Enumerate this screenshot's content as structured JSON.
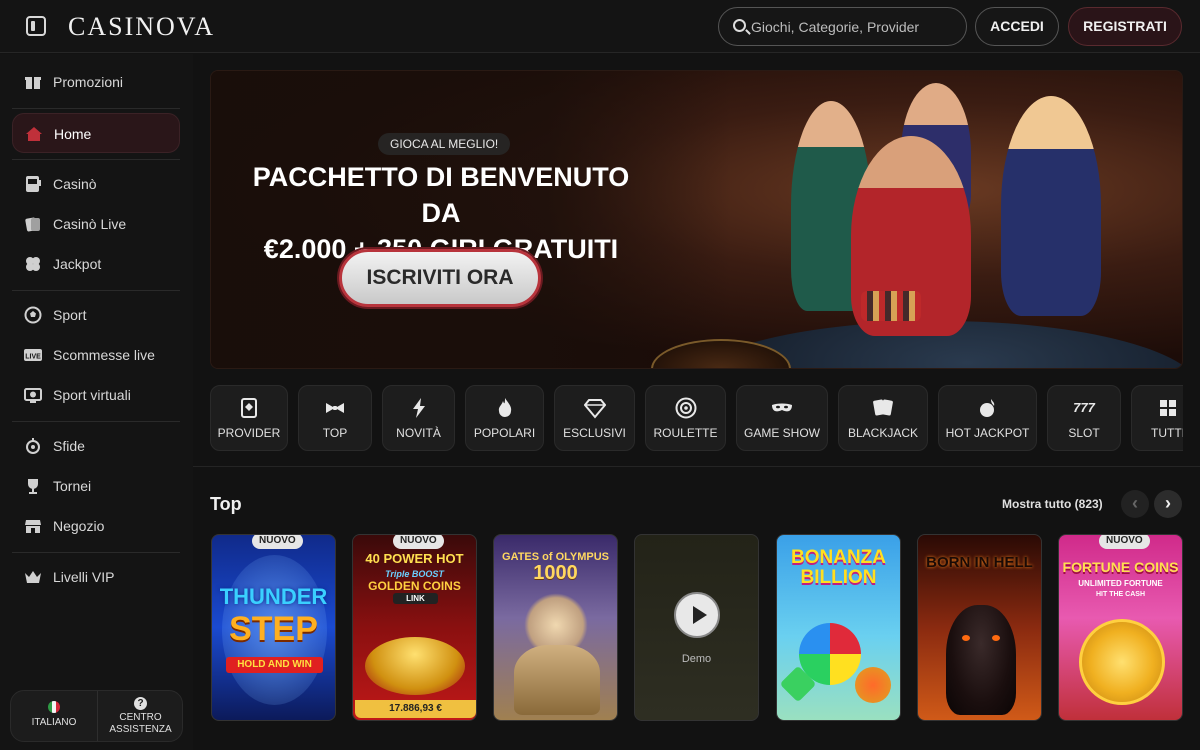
{
  "header": {
    "logo": "CASINOVA",
    "search_placeholder": "Giochi, Categorie, Provider",
    "login_label": "ACCEDI",
    "register_label": "REGISTRATI"
  },
  "sidebar": {
    "items": [
      {
        "label": "Promozioni",
        "icon": "gift-icon"
      },
      {
        "label": "Home",
        "icon": "home-icon",
        "active": true
      },
      {
        "label": "Casinò",
        "icon": "slot-machine-icon"
      },
      {
        "label": "Casinò Live",
        "icon": "live-cards-icon"
      },
      {
        "label": "Jackpot",
        "icon": "clover-icon"
      },
      {
        "label": "Sport",
        "icon": "soccer-ball-icon"
      },
      {
        "label": "Scommesse live",
        "icon": "live-icon"
      },
      {
        "label": "Sport virtuali",
        "icon": "virtual-sport-icon"
      },
      {
        "label": "Sfide",
        "icon": "challenge-icon"
      },
      {
        "label": "Tornei",
        "icon": "trophy-icon"
      },
      {
        "label": "Negozio",
        "icon": "shop-icon"
      },
      {
        "label": "Livelli VIP",
        "icon": "crown-icon"
      }
    ],
    "language_label": "ITALIANO",
    "help_label_1": "CENTRO",
    "help_label_2": "ASSISTENZA"
  },
  "banner": {
    "tag": "GIOCA AL MEGLIO!",
    "title_line1": "PACCHETTO DI BENVENUTO DA",
    "title_line2": "€2.000 + 350 GIRI GRATUITI",
    "cta": "ISCRIVITI ORA"
  },
  "categories": [
    {
      "label": "PROVIDER",
      "icon": "provider-icon"
    },
    {
      "label": "TOP",
      "icon": "bow-tie-icon"
    },
    {
      "label": "NOVITÀ",
      "icon": "lightning-icon"
    },
    {
      "label": "POPOLARI",
      "icon": "flame-icon"
    },
    {
      "label": "ESCLUSIVI",
      "icon": "diamond-icon"
    },
    {
      "label": "ROULETTE",
      "icon": "roulette-icon"
    },
    {
      "label": "GAME SHOW",
      "icon": "mask-icon"
    },
    {
      "label": "BLACKJACK",
      "icon": "cards-icon"
    },
    {
      "label": "HOT JACKPOT",
      "icon": "hot-jackpot-icon"
    },
    {
      "label": "SLOT",
      "icon": "slot-777-icon"
    },
    {
      "label": "TUTTI",
      "icon": "grid-icon"
    }
  ],
  "top_section": {
    "title": "Top",
    "show_all": "Mostra tutto (823)"
  },
  "games": [
    {
      "title_1": "THUNDER",
      "title_2": "STEP",
      "title_3": "HOLD AND WIN",
      "badge": "NUOVO"
    },
    {
      "title_1": "40 POWER HOT",
      "title_2": "Triple BOOST",
      "title_3": "GOLDEN COINS",
      "title_4": "LINK",
      "badge": "NUOVO",
      "jackpot": "17.886,93 €"
    },
    {
      "title_1": "GATES of OLYMPUS",
      "title_2": "1000"
    },
    {
      "demo_label": "Demo"
    },
    {
      "title_1": "BONANZA",
      "title_2": "BILLION"
    },
    {
      "title_1": "BORN IN HELL"
    },
    {
      "title_1": "FORTUNE COINS",
      "title_2": "UNLIMITED FORTUNE",
      "title_3": "HIT THE CASH",
      "badge": "NUOVO"
    }
  ]
}
